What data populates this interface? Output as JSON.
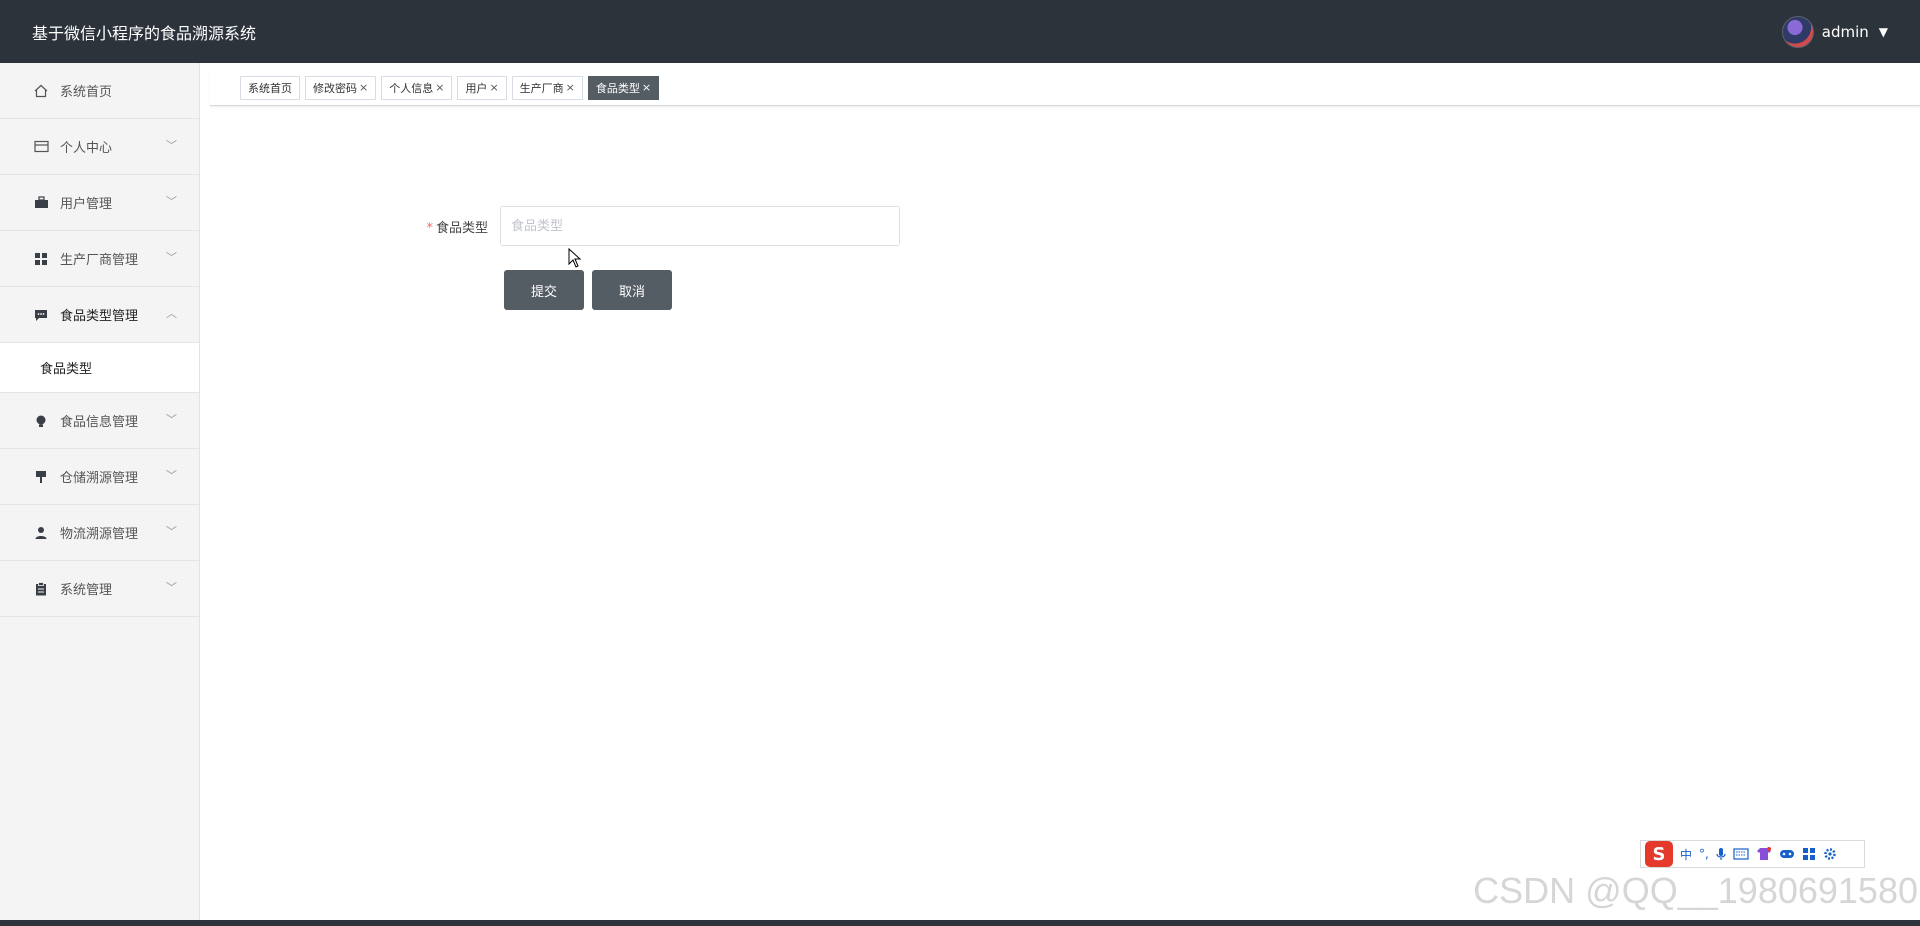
{
  "header": {
    "title": "基于微信小程序的食品溯源系统",
    "username": "admin",
    "caret": "▼"
  },
  "sidebar": {
    "items": [
      {
        "label": "系统首页",
        "icon": "home-icon",
        "has_chevron": false
      },
      {
        "label": "个人中心",
        "icon": "card-icon",
        "has_chevron": true,
        "chevron": "﹀"
      },
      {
        "label": "用户管理",
        "icon": "briefcase-icon",
        "has_chevron": true,
        "chevron": "﹀"
      },
      {
        "label": "生产厂商管理",
        "icon": "grid-icon",
        "has_chevron": true,
        "chevron": "﹀"
      },
      {
        "label": "食品类型管理",
        "icon": "chat-icon",
        "has_chevron": true,
        "chevron": "︿",
        "expanded": true
      },
      {
        "label": "食品信息管理",
        "icon": "bulb-icon",
        "has_chevron": true,
        "chevron": "﹀"
      },
      {
        "label": "仓储溯源管理",
        "icon": "pin-icon",
        "has_chevron": true,
        "chevron": "﹀"
      },
      {
        "label": "物流溯源管理",
        "icon": "person-icon",
        "has_chevron": true,
        "chevron": "﹀"
      },
      {
        "label": "系统管理",
        "icon": "clipboard-icon",
        "has_chevron": true,
        "chevron": "﹀"
      }
    ],
    "submenu": {
      "label": "食品类型"
    }
  },
  "tabs": [
    {
      "label": "系统首页",
      "closable": false,
      "active": false
    },
    {
      "label": "修改密码",
      "closable": true,
      "active": false
    },
    {
      "label": "个人信息",
      "closable": true,
      "active": false
    },
    {
      "label": "用户",
      "closable": true,
      "active": false
    },
    {
      "label": "生产厂商",
      "closable": true,
      "active": false
    },
    {
      "label": "食品类型",
      "closable": true,
      "active": true
    }
  ],
  "tab_close_glyph": "×",
  "form": {
    "required_mark": "*",
    "label": "食品类型",
    "placeholder": "食品类型",
    "value": "",
    "submit_label": "提交",
    "cancel_label": "取消"
  },
  "ime": {
    "logo": "S",
    "mode": "中",
    "punct": "°,",
    "icons": [
      "mic-icon",
      "keyboard-icon",
      "shirt-icon",
      "gamepad-icon",
      "apps-icon",
      "settings-icon"
    ]
  },
  "watermark": "CSDN @QQ__1980691580",
  "colors": {
    "topbar": "#2c333b",
    "active_tab": "#545c64",
    "button": "#545c64",
    "required": "#f56c6c",
    "ime_blue": "#1560c9",
    "ime_red": "#e33a2b"
  }
}
